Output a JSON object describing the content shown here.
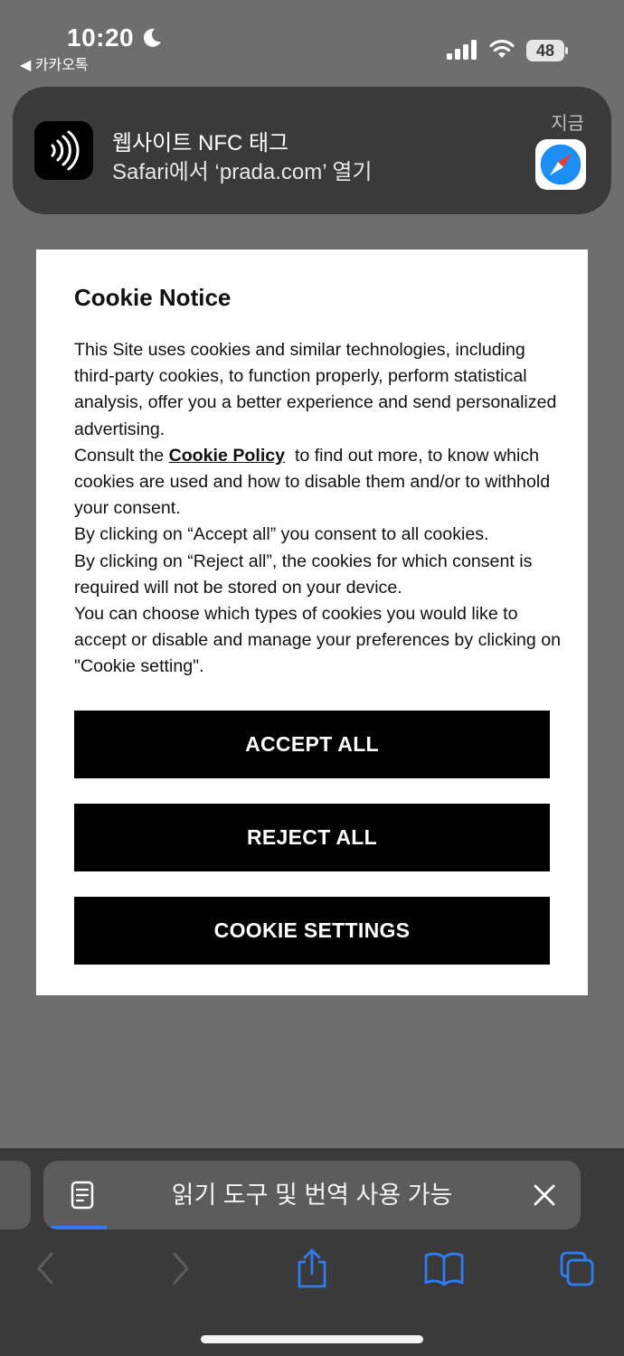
{
  "status_bar": {
    "time": "10:20",
    "back_app": "◀ 카카오톡",
    "battery": "48",
    "icons": [
      "moon-icon",
      "signal-icon",
      "wifi-icon",
      "battery-icon"
    ]
  },
  "notification": {
    "title": "웹사이트 NFC 태그",
    "body": "Safari에서 ‘prada.com’ 열기",
    "time": "지금",
    "app_icon": "nfc-icon",
    "target_icon": "safari-icon"
  },
  "cookie_notice": {
    "title": "Cookie Notice",
    "p1": "This Site uses cookies and similar technologies, including third-party cookies, to function properly, perform statistical analysis, offer you a better experience and send personalized advertising.",
    "p2_pre": "Consult the ",
    "p2_link": "Cookie Policy",
    "p2_post": "  to find out more, to know which cookies are used and how to disable them and/or to withhold your consent.",
    "p3": "By clicking on “Accept all” you consent to all cookies.",
    "p4": "By clicking on “Reject all”, the cookies for which consent is required will not be stored on your device.",
    "p5": "You can choose which types of cookies you would like to accept or disable and manage your preferences by clicking on \"Cookie setting\".",
    "buttons": {
      "accept": "ACCEPT ALL",
      "reject": "REJECT ALL",
      "settings": "COOKIE SETTINGS"
    }
  },
  "safari_bar": {
    "reader_text": "읽기 도구 및 번역 사용 가능",
    "toolbar": [
      "back-icon",
      "forward-icon",
      "share-icon",
      "bookmarks-icon",
      "tabs-icon"
    ]
  },
  "colors": {
    "background": "#6e6e6e",
    "notification": "#3a3a3a",
    "button": "#000000",
    "progress": "#2f7df6"
  }
}
